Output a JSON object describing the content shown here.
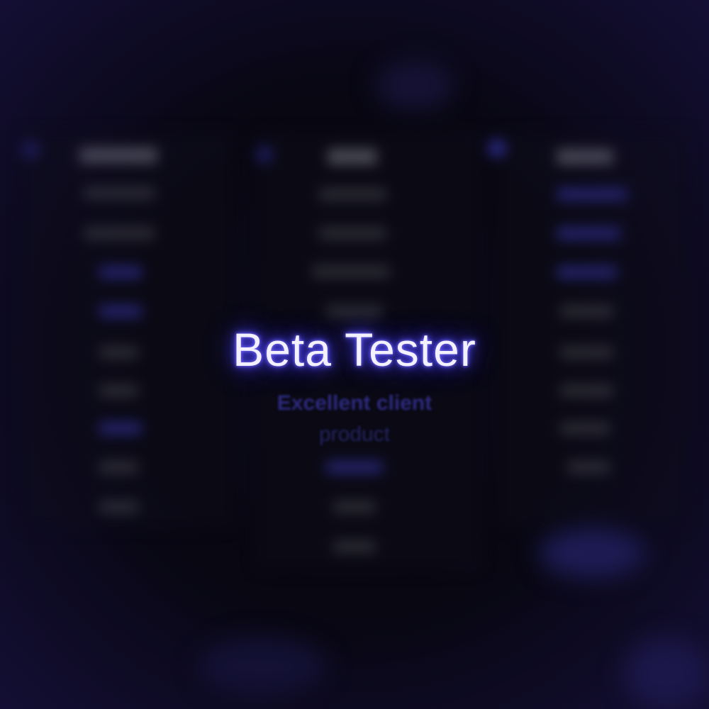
{
  "hero": {
    "title": "Beta Tester",
    "subtitle_line1": "Excellent client",
    "subtitle_line2": "product"
  },
  "colors": {
    "background": "#05040c",
    "title_glow": "#5b52ff",
    "subtitle": "#2d2a7e",
    "accent_blue": "#24226a"
  }
}
